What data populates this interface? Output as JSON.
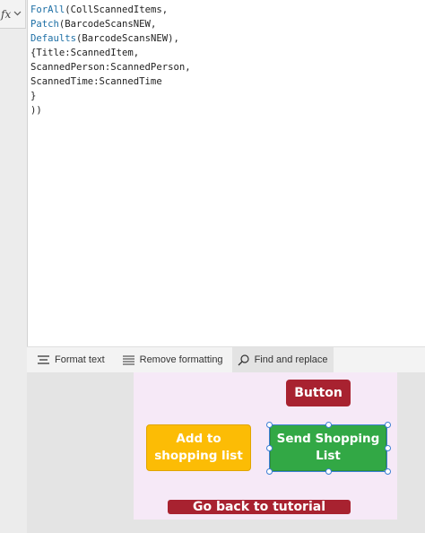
{
  "formula_bar": {
    "fx_symbol": "fx",
    "dropdown_glyph": "chevron-down-icon"
  },
  "editor": {
    "code_lines": [
      {
        "fn": "ForAll",
        "rest": "(CollScannedItems,"
      },
      {
        "fn": "Patch",
        "rest": "(BarcodeScansNEW,"
      },
      {
        "fn": "Defaults",
        "rest": "(BarcodeScansNEW),"
      },
      {
        "fn": "",
        "rest": "{Title:ScannedItem,"
      },
      {
        "fn": "",
        "rest": "ScannedPerson:ScannedPerson,"
      },
      {
        "fn": "",
        "rest": "ScannedTime:ScannedTime"
      },
      {
        "fn": "",
        "rest": "}"
      },
      {
        "fn": "",
        "rest": "))"
      }
    ]
  },
  "toolbar": {
    "format_text": "Format text",
    "remove_formatting": "Remove formatting",
    "find_replace": "Find and replace"
  },
  "canvas": {
    "button_label": "Button",
    "add_label": "Add to shopping list",
    "send_label": "Send Shopping List",
    "back_label": "Go back to tutorial"
  },
  "colors": {
    "red": "#a82230",
    "yellow": "#fcbc05",
    "green": "#32a845",
    "canvas_bg": "#f6e9f7",
    "selection": "#3b7fd4"
  }
}
